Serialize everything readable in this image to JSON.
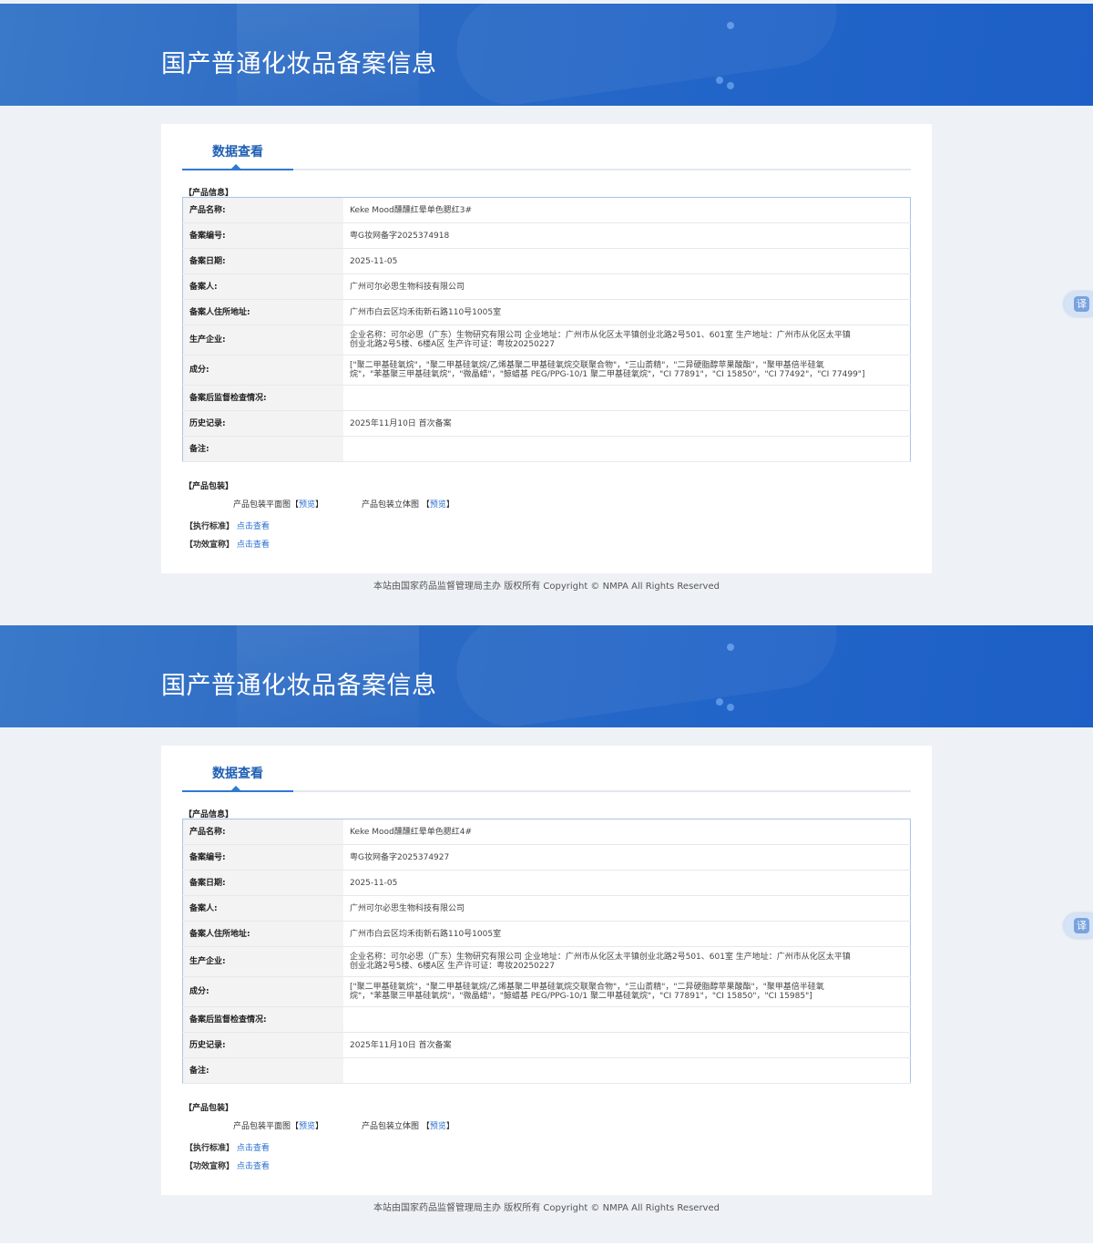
{
  "pages": [
    {
      "banner_title": "国产普通化妆品备案信息",
      "tab_label": "数据查看",
      "section_product_info": "【产品信息】",
      "rows": [
        {
          "label": "产品名称:",
          "value": "Keke Mood醺醺红晕单色腮红3#"
        },
        {
          "label": "备案编号:",
          "value": "粤G妆网备字2025374918"
        },
        {
          "label": "备案日期:",
          "value": "2025-11-05"
        },
        {
          "label": "备案人:",
          "value": "广州可尔必思生物科技有限公司"
        },
        {
          "label": "备案人住所地址:",
          "value": "广州市白云区均禾街新石路110号1005室"
        },
        {
          "label": "生产企业:",
          "value_line1": "企业名称：可尔必思（广东）生物研究有限公司 企业地址：广州市从化区太平镇创业北路2号501、601室 生产地址：广州市从化区太平镇",
          "value_line2": "创业北路2号5楼、6楼A区 生产许可证：粤妆20250227"
        },
        {
          "label": "成分:",
          "value_line1": "[\"聚二甲基硅氧烷\"，\"聚二甲基硅氧烷/乙烯基聚二甲基硅氧烷交联聚合物\"，\"三山萮精\"，\"二异硬脂醇苹果酸酯\"，\"聚甲基倍半硅氧",
          "value_line2": "烷\"，\"苯基聚三甲基硅氧烷\"，\"微晶蜡\"，\"鲸蜡基 PEG/PPG-10/1 聚二甲基硅氧烷\"，\"CI 77891\"，\"CI 15850\"，\"CI 77492\"，\"CI 77499\"]"
        },
        {
          "label": "备案后监督检查情况:",
          "value": ""
        },
        {
          "label": "历史记录:",
          "value": "2025年11月10日 首次备案"
        },
        {
          "label": "备注:",
          "value": ""
        }
      ],
      "section_packaging": "【产品包装】",
      "pkg_flat_label": "产品包装平面图",
      "pkg_3d_label": "产品包装立体图",
      "preview_link": "预览",
      "bracket_open": "【",
      "bracket_close": "】",
      "standard_label": "【执行标准】",
      "claim_label": "【功效宣称】",
      "view_link": "点击查看",
      "footer": "本站由国家药品监督管理局主办 版权所有 Copyright © NMPA All Rights Reserved",
      "translate": "译"
    },
    {
      "banner_title": "国产普通化妆品备案信息",
      "tab_label": "数据查看",
      "section_product_info": "【产品信息】",
      "rows": [
        {
          "label": "产品名称:",
          "value": "Keke Mood醺醺红晕单色腮红4#"
        },
        {
          "label": "备案编号:",
          "value": "粤G妆网备字2025374927"
        },
        {
          "label": "备案日期:",
          "value": "2025-11-05"
        },
        {
          "label": "备案人:",
          "value": "广州可尔必思生物科技有限公司"
        },
        {
          "label": "备案人住所地址:",
          "value": "广州市白云区均禾街新石路110号1005室"
        },
        {
          "label": "生产企业:",
          "value_line1": "企业名称：可尔必思（广东）生物研究有限公司 企业地址：广州市从化区太平镇创业北路2号501、601室 生产地址：广州市从化区太平镇",
          "value_line2": "创业北路2号5楼、6楼A区 生产许可证：粤妆20250227"
        },
        {
          "label": "成分:",
          "value_line1": "[\"聚二甲基硅氧烷\"，\"聚二甲基硅氧烷/乙烯基聚二甲基硅氧烷交联聚合物\"，\"三山萮精\"，\"二异硬脂醇苹果酸酯\"，\"聚甲基倍半硅氧",
          "value_line2": "烷\"，\"苯基聚三甲基硅氧烷\"，\"微晶蜡\"，\"鲸蜡基 PEG/PPG-10/1 聚二甲基硅氧烷\"，\"CI 77891\"，\"CI 15850\"，\"CI 15985\"]"
        },
        {
          "label": "备案后监督检查情况:",
          "value": ""
        },
        {
          "label": "历史记录:",
          "value": "2025年11月10日 首次备案"
        },
        {
          "label": "备注:",
          "value": ""
        }
      ],
      "section_packaging": "【产品包装】",
      "pkg_flat_label": "产品包装平面图",
      "pkg_3d_label": "产品包装立体图",
      "preview_link": "预览",
      "bracket_open": "【",
      "bracket_close": "】",
      "standard_label": "【执行标准】",
      "claim_label": "【功效宣称】",
      "view_link": "点击查看",
      "footer": "本站由国家药品监督管理局主办 版权所有 Copyright © NMPA All Rights Reserved",
      "translate": "译"
    }
  ],
  "colors": {
    "banner": "#2366c8",
    "accent": "#2f79d2",
    "link": "#2a6fd0"
  }
}
